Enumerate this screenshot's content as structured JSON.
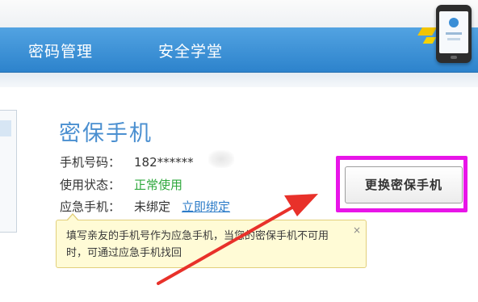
{
  "nav": {
    "items": [
      "密码管理",
      "安全学堂"
    ]
  },
  "card": {
    "title": "密保手机",
    "phone_label": "手机号码：",
    "phone_value": "182******",
    "status_label": "使用状态：",
    "status_value": "正常使用",
    "backup_label": "应急手机：",
    "backup_value": "未绑定",
    "bind_link": "立即绑定"
  },
  "tooltip": {
    "text": "填写亲友的手机号作为应急手机，当您的密保手机不可用时，可通过应急手机找回",
    "close": "×"
  },
  "actions": {
    "change_phone": "更换密保手机"
  },
  "colors": {
    "nav_blue": "#2d83cc",
    "title_blue": "#4a8fd0",
    "status_green": "#2fa83c",
    "highlight_magenta": "#e815e8",
    "annotation_red": "#e8312a"
  },
  "icons": {
    "phone_graphic": "phone-lock-icon"
  }
}
